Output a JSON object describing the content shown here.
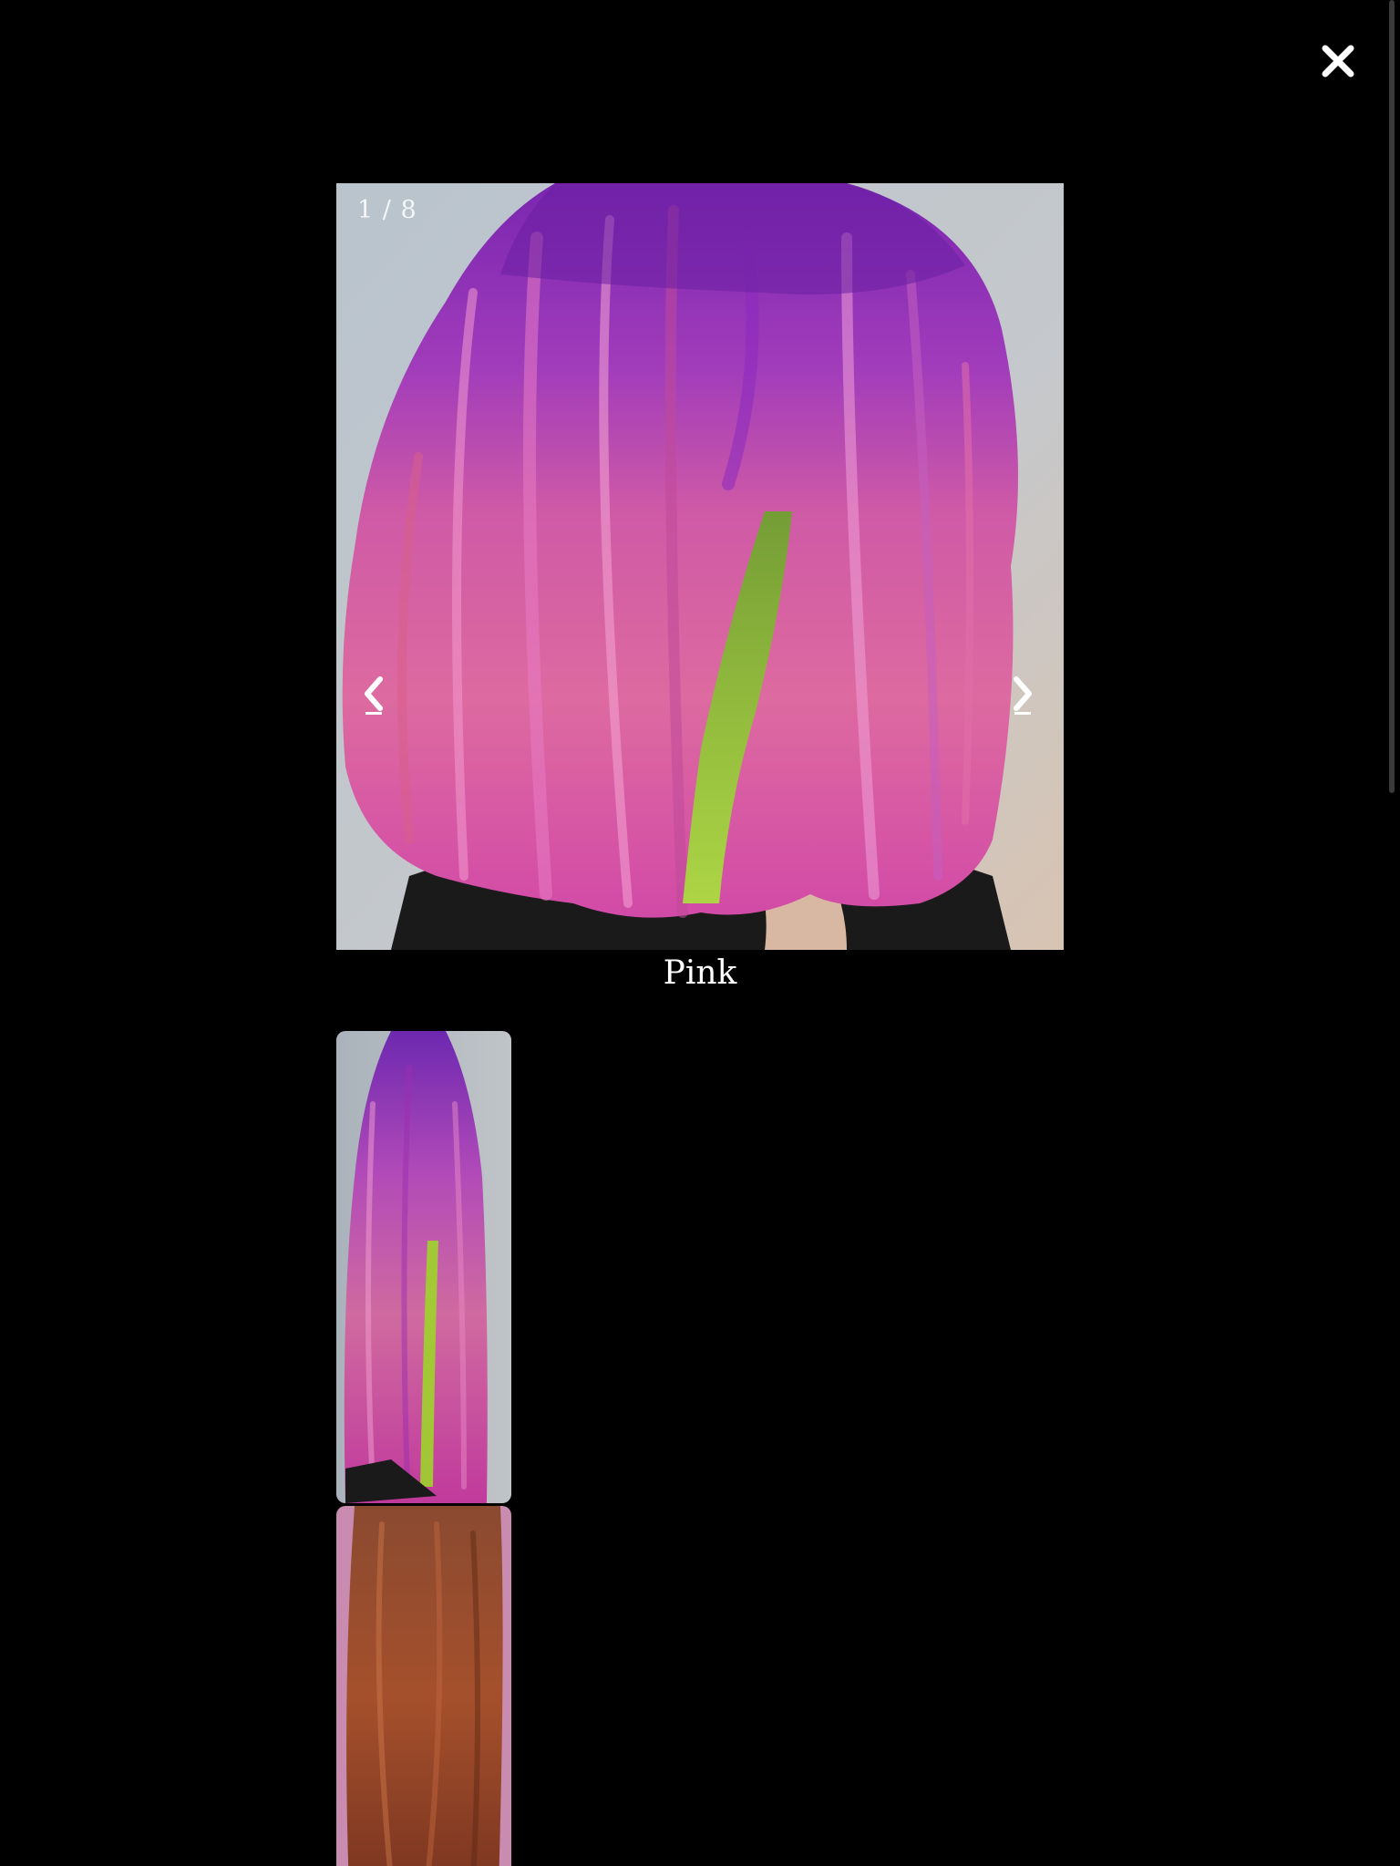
{
  "lightbox": {
    "counter": "1 / 8",
    "caption": "Pink",
    "icons": {
      "close": "close-icon",
      "prev": "chevron-left-icon",
      "next": "chevron-right-icon"
    },
    "thumbnails": [
      {
        "name": "thumbnail-pink-long-hair",
        "palette": [
          "#7a2bb5",
          "#c8559c",
          "#9fd42a"
        ]
      },
      {
        "name": "thumbnail-copper-long-hair",
        "palette": [
          "#c88ab0",
          "#a5502c",
          "#6e2e1a"
        ]
      }
    ]
  },
  "colors": {
    "background": "#000000",
    "foreground": "#ffffff"
  }
}
